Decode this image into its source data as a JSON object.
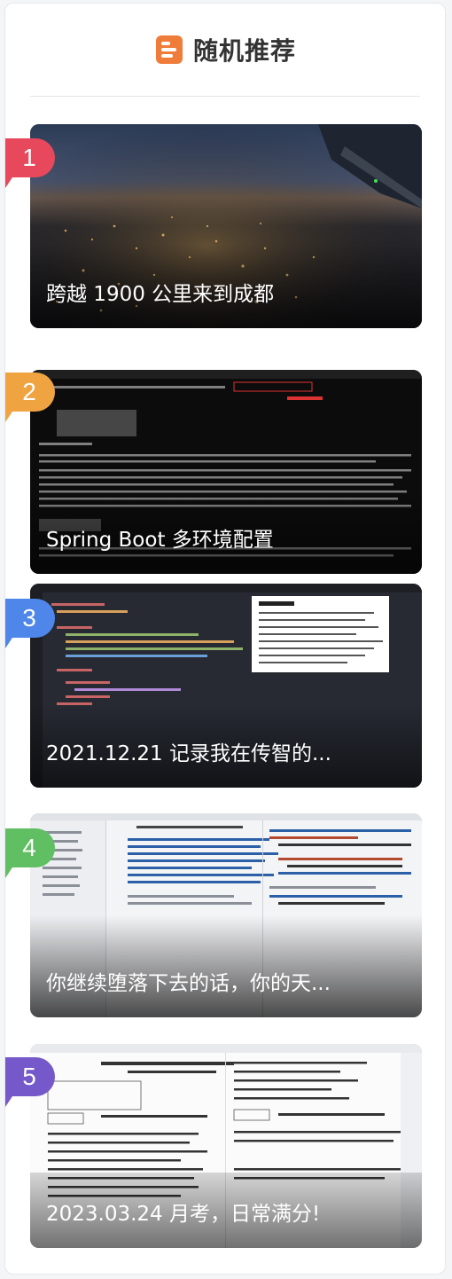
{
  "widget": {
    "title": "随机推荐",
    "icon": "article-list-icon",
    "accent": "#f07c3a"
  },
  "items": [
    {
      "rank": "1",
      "title": "跨越 1900 公里来到成都",
      "badge_color": "#e7485c",
      "image": "night-city-from-airplane"
    },
    {
      "rank": "2",
      "title": "Spring Boot 多环境配置",
      "badge_color": "#f0a441",
      "image": "terminal-spring-boot-log"
    },
    {
      "rank": "3",
      "title": "2021.12.21 记录我在传智的...",
      "badge_color": "#4e86e9",
      "image": "code-editor-screenshot"
    },
    {
      "rank": "4",
      "title": "你继续堕落下去的话，你的天...",
      "badge_color": "#5fbf62",
      "image": "python-ide-screenshot"
    },
    {
      "rank": "5",
      "title": "2023.03.24 月考，日常满分!",
      "badge_color": "#7558c9",
      "image": "exam-paper-scan"
    }
  ]
}
